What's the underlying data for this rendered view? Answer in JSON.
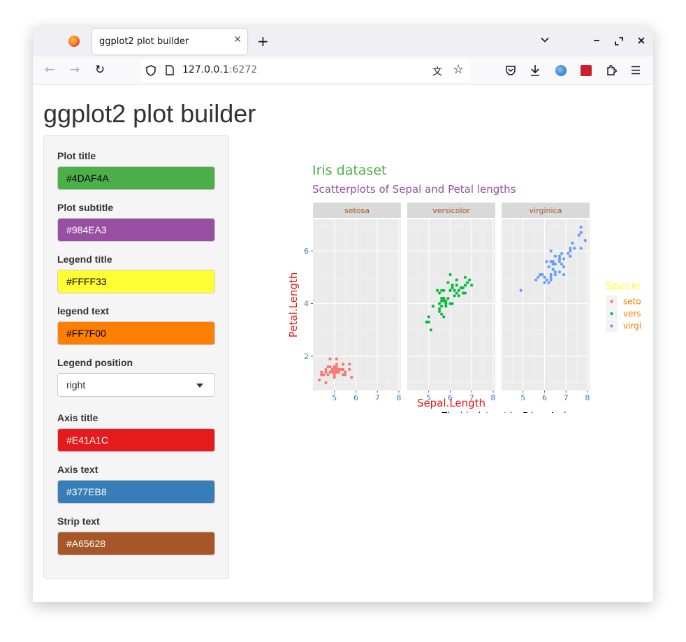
{
  "browser": {
    "tab_title": "ggplot2 plot builder",
    "new_tab": "+",
    "url_host": "127.0.0.1",
    "url_port": ":6272"
  },
  "page": {
    "title": "ggplot2 plot builder"
  },
  "form": {
    "fields": [
      {
        "label": "Plot title",
        "value": "#4DAF4A",
        "text_color": "#000000"
      },
      {
        "label": "Plot subtitle",
        "value": "#984EA3",
        "text_color": "#ffffff"
      },
      {
        "label": "Legend title",
        "value": "#FFFF33",
        "text_color": "#000000"
      },
      {
        "label": "legend text",
        "value": "#FF7F00",
        "text_color": "#000000"
      }
    ],
    "legend_position": {
      "label": "Legend position",
      "value": "right"
    },
    "fields2": [
      {
        "label": "Axis title",
        "value": "#E41A1C",
        "text_color": "#ffffff"
      },
      {
        "label": "Axis text",
        "value": "#377EB8",
        "text_color": "#ffffff"
      },
      {
        "label": "Strip text",
        "value": "#A65628",
        "text_color": "#ffffff"
      }
    ]
  },
  "chart_data": {
    "type": "scatter",
    "title": "Iris dataset",
    "subtitle": "Scatterplots of Sepal and Petal lengths",
    "caption": "The iris dataset by Edgar Anderson",
    "xlabel": "Sepal.Length",
    "ylabel": "Petal.Length",
    "xlim": [
      4.0,
      8.1
    ],
    "ylim": [
      0.7,
      7.2
    ],
    "xticks": [
      5,
      6,
      7,
      8
    ],
    "yticks": [
      2,
      4,
      6
    ],
    "grid": true,
    "legend_position": "right",
    "legend_title": "Species",
    "colors": {
      "title": "#4DAF4A",
      "subtitle": "#984EA3",
      "legend_title": "#FFFF33",
      "legend_text": "#FF7F00",
      "axis_title": "#E41A1C",
      "axis_text": "#377EB8",
      "strip_text": "#A65628"
    },
    "panels": [
      {
        "name": "setosa",
        "color": "#F8766D",
        "points": [
          [
            5.1,
            1.4
          ],
          [
            4.9,
            1.4
          ],
          [
            4.7,
            1.3
          ],
          [
            4.6,
            1.5
          ],
          [
            5.0,
            1.4
          ],
          [
            5.4,
            1.7
          ],
          [
            4.6,
            1.4
          ],
          [
            5.0,
            1.5
          ],
          [
            4.4,
            1.4
          ],
          [
            4.9,
            1.5
          ],
          [
            5.4,
            1.5
          ],
          [
            4.8,
            1.6
          ],
          [
            4.8,
            1.4
          ],
          [
            4.3,
            1.1
          ],
          [
            5.8,
            1.2
          ],
          [
            5.7,
            1.5
          ],
          [
            5.4,
            1.3
          ],
          [
            5.1,
            1.4
          ],
          [
            5.7,
            1.7
          ],
          [
            5.1,
            1.5
          ],
          [
            5.4,
            1.7
          ],
          [
            5.1,
            1.5
          ],
          [
            4.6,
            1.0
          ],
          [
            5.1,
            1.7
          ],
          [
            4.8,
            1.9
          ],
          [
            5.0,
            1.6
          ],
          [
            5.0,
            1.6
          ],
          [
            5.2,
            1.5
          ],
          [
            5.2,
            1.4
          ],
          [
            4.7,
            1.6
          ],
          [
            4.8,
            1.6
          ],
          [
            5.4,
            1.5
          ],
          [
            5.2,
            1.5
          ],
          [
            5.5,
            1.4
          ],
          [
            4.9,
            1.5
          ],
          [
            5.0,
            1.2
          ],
          [
            5.5,
            1.3
          ],
          [
            4.9,
            1.4
          ],
          [
            4.4,
            1.3
          ],
          [
            5.1,
            1.5
          ],
          [
            5.0,
            1.3
          ],
          [
            4.5,
            1.3
          ],
          [
            4.4,
            1.3
          ],
          [
            5.0,
            1.6
          ],
          [
            5.1,
            1.9
          ],
          [
            4.8,
            1.4
          ],
          [
            5.1,
            1.6
          ],
          [
            4.6,
            1.4
          ],
          [
            5.3,
            1.5
          ],
          [
            5.0,
            1.4
          ]
        ]
      },
      {
        "name": "versicolor",
        "color": "#00BA38",
        "points": [
          [
            7.0,
            4.7
          ],
          [
            6.4,
            4.5
          ],
          [
            6.9,
            4.9
          ],
          [
            5.5,
            4.0
          ],
          [
            6.5,
            4.6
          ],
          [
            5.7,
            4.5
          ],
          [
            6.3,
            4.7
          ],
          [
            4.9,
            3.3
          ],
          [
            6.6,
            4.6
          ],
          [
            5.2,
            3.9
          ],
          [
            5.0,
            3.5
          ],
          [
            5.9,
            4.2
          ],
          [
            6.0,
            4.0
          ],
          [
            6.1,
            4.7
          ],
          [
            5.6,
            3.6
          ],
          [
            6.7,
            4.4
          ],
          [
            5.6,
            4.5
          ],
          [
            5.8,
            4.1
          ],
          [
            6.2,
            4.5
          ],
          [
            5.6,
            3.9
          ],
          [
            5.9,
            4.8
          ],
          [
            6.1,
            4.0
          ],
          [
            6.3,
            4.9
          ],
          [
            6.1,
            4.7
          ],
          [
            6.4,
            4.3
          ],
          [
            6.6,
            4.4
          ],
          [
            6.8,
            4.8
          ],
          [
            6.7,
            5.0
          ],
          [
            6.0,
            4.5
          ],
          [
            5.7,
            3.5
          ],
          [
            5.5,
            3.8
          ],
          [
            5.5,
            3.7
          ],
          [
            5.8,
            3.9
          ],
          [
            6.0,
            5.1
          ],
          [
            5.4,
            4.5
          ],
          [
            6.0,
            4.5
          ],
          [
            6.7,
            4.7
          ],
          [
            6.3,
            4.4
          ],
          [
            5.6,
            4.1
          ],
          [
            5.5,
            4.0
          ],
          [
            5.5,
            4.4
          ],
          [
            6.1,
            4.6
          ],
          [
            5.8,
            4.0
          ],
          [
            5.0,
            3.3
          ],
          [
            5.6,
            4.2
          ],
          [
            5.7,
            4.2
          ],
          [
            5.7,
            4.2
          ],
          [
            6.2,
            4.3
          ],
          [
            5.1,
            3.0
          ],
          [
            5.7,
            4.1
          ]
        ]
      },
      {
        "name": "virginica",
        "color": "#619CFF",
        "points": [
          [
            6.3,
            6.0
          ],
          [
            5.8,
            5.1
          ],
          [
            7.1,
            5.9
          ],
          [
            6.3,
            5.6
          ],
          [
            6.5,
            5.8
          ],
          [
            7.6,
            6.6
          ],
          [
            4.9,
            4.5
          ],
          [
            7.3,
            6.3
          ],
          [
            6.7,
            5.8
          ],
          [
            7.2,
            6.1
          ],
          [
            6.5,
            5.1
          ],
          [
            6.4,
            5.3
          ],
          [
            6.8,
            5.5
          ],
          [
            5.7,
            5.0
          ],
          [
            5.8,
            5.1
          ],
          [
            6.4,
            5.3
          ],
          [
            6.5,
            5.5
          ],
          [
            7.7,
            6.7
          ],
          [
            7.7,
            6.9
          ],
          [
            6.0,
            5.0
          ],
          [
            6.9,
            5.7
          ],
          [
            5.6,
            4.9
          ],
          [
            7.7,
            6.7
          ],
          [
            6.3,
            4.9
          ],
          [
            6.7,
            5.7
          ],
          [
            7.2,
            6.0
          ],
          [
            6.2,
            4.8
          ],
          [
            6.1,
            4.9
          ],
          [
            6.4,
            5.6
          ],
          [
            7.2,
            5.8
          ],
          [
            7.4,
            6.1
          ],
          [
            7.9,
            6.4
          ],
          [
            6.4,
            5.6
          ],
          [
            6.3,
            5.1
          ],
          [
            6.1,
            5.6
          ],
          [
            7.7,
            6.1
          ],
          [
            6.3,
            5.6
          ],
          [
            6.4,
            5.5
          ],
          [
            6.0,
            4.8
          ],
          [
            6.9,
            5.4
          ],
          [
            6.7,
            5.6
          ],
          [
            6.9,
            5.1
          ],
          [
            5.8,
            5.1
          ],
          [
            6.8,
            5.9
          ],
          [
            6.7,
            5.7
          ],
          [
            6.7,
            5.2
          ],
          [
            6.3,
            5.0
          ],
          [
            6.5,
            5.2
          ],
          [
            6.2,
            5.4
          ],
          [
            5.9,
            5.1
          ]
        ]
      }
    ]
  }
}
